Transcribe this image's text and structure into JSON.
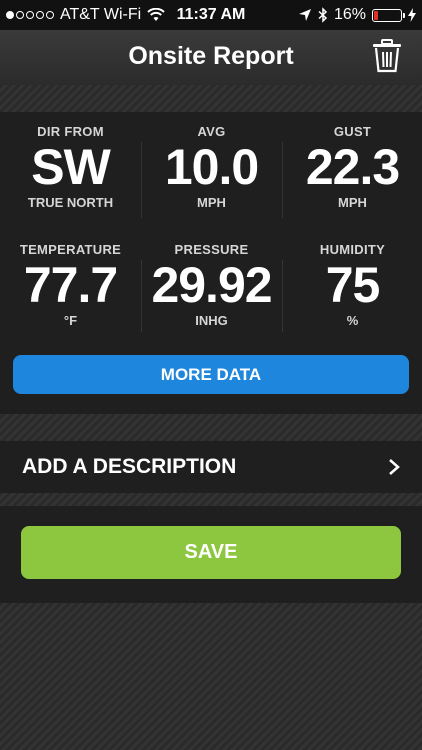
{
  "status_bar": {
    "carrier": "AT&T Wi-Fi",
    "time": "11:37 AM",
    "battery_percent": "16%",
    "battery_level": 0.16
  },
  "header": {
    "title": "Onsite Report"
  },
  "stats": [
    {
      "label": "DIR FROM",
      "value": "SW",
      "unit": "TRUE NORTH"
    },
    {
      "label": "AVG",
      "value": "10.0",
      "unit": "MPH"
    },
    {
      "label": "GUST",
      "value": "22.3",
      "unit": "MPH"
    },
    {
      "label": "TEMPERATURE",
      "value": "77.7",
      "unit": "°F"
    },
    {
      "label": "PRESSURE",
      "value": "29.92",
      "unit": "INHG"
    },
    {
      "label": "HUMIDITY",
      "value": "75",
      "unit": "%"
    }
  ],
  "more_data_label": "MORE DATA",
  "description_label": "ADD A DESCRIPTION",
  "save_label": "SAVE",
  "colors": {
    "more_button": "#1f86dd",
    "save_button": "#8dc63f",
    "battery_low": "#e0302a"
  }
}
